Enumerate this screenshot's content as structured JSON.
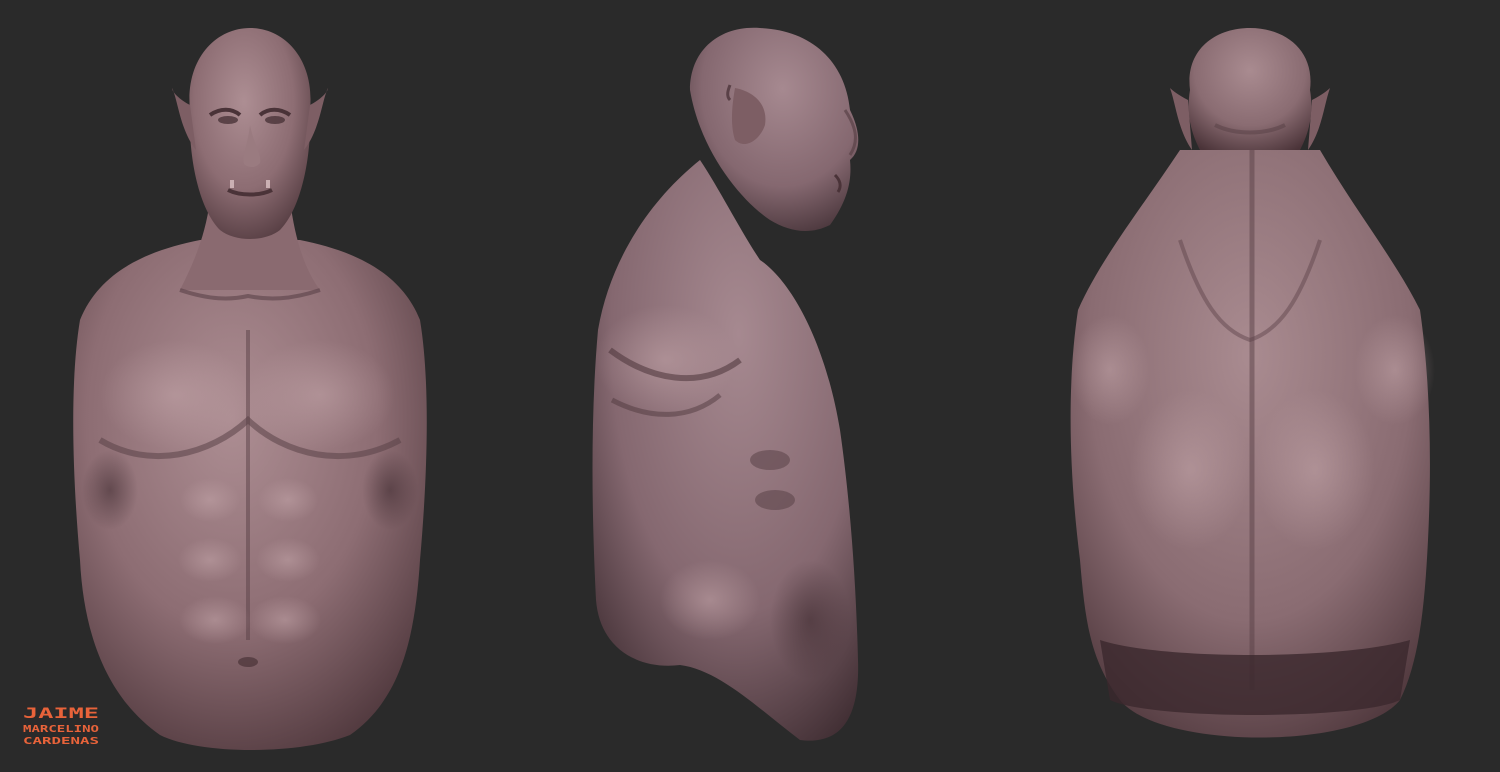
{
  "scene": {
    "background": "#2a2a2a",
    "skin_color": "#8d6d73",
    "skin_highlight": "#ad8e93",
    "skin_shadow": "#4a3338",
    "views": [
      {
        "name": "front-view",
        "label": ""
      },
      {
        "name": "side-view",
        "label": ""
      },
      {
        "name": "back-view",
        "label": ""
      }
    ]
  },
  "logo": {
    "brand_color": "#e8633a",
    "line1": "JAIME",
    "line2": "MARCELINO",
    "line3": "CARDENAS"
  }
}
